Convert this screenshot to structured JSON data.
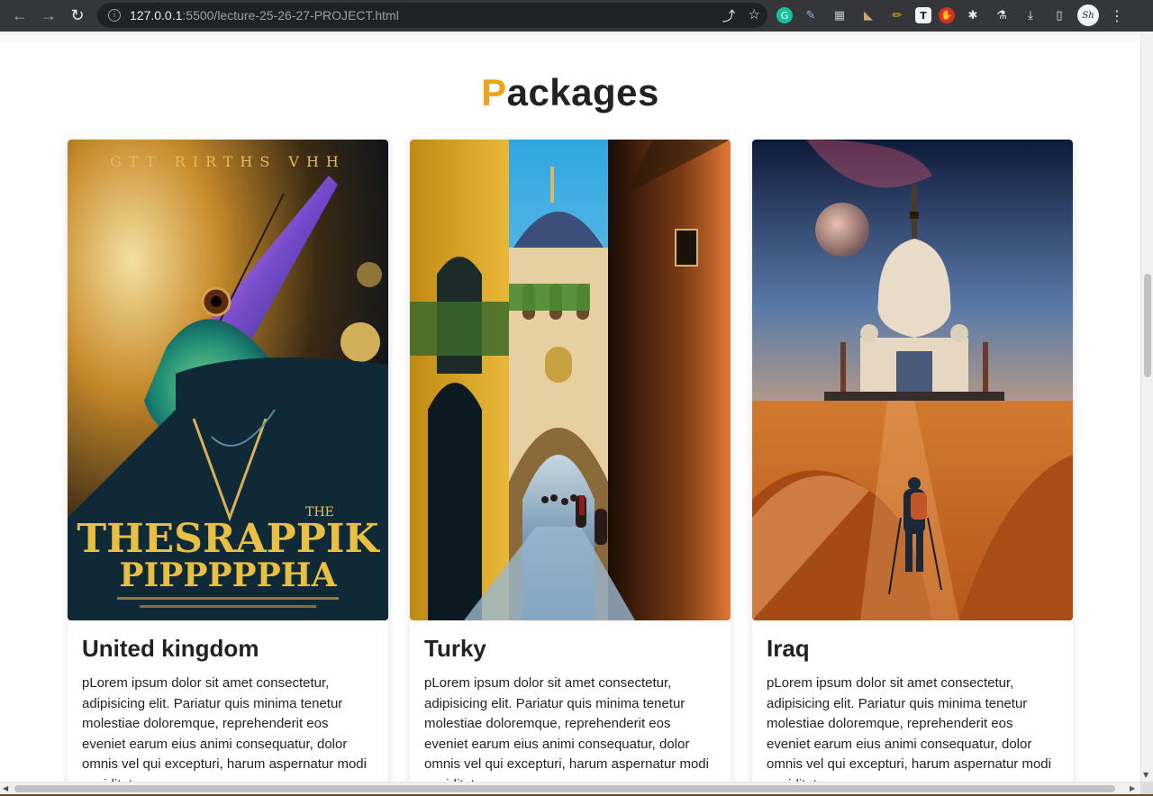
{
  "browser": {
    "url_host": "127.0.0.1",
    "url_rest": ":5500/lecture-25-26-27-PROJECT.html",
    "icons": [
      "back-arrow-icon",
      "forward-arrow-icon",
      "reload-icon",
      "site-info-icon",
      "share-icon",
      "bookmark-star-icon",
      "grammarly-icon",
      "eyedropper-icon",
      "extension-icon",
      "extension-icon",
      "pencil-icon",
      "extension-icon",
      "extension-icon",
      "puzzle-icon",
      "flask-icon",
      "download-icon",
      "sidepanel-icon",
      "profile-avatar",
      "more-menu-icon"
    ]
  },
  "section": {
    "heading_first": "P",
    "heading_rest": "ackages"
  },
  "cards": [
    {
      "title": "United kingdom",
      "text": "pLorem ipsum dolor sit amet consectetur, adipisicing elit. Pariatur quis minima tenetur molestiae doloremque, reprehenderit eos eveniet earum eius animi consequatur, dolor omnis vel qui excepturi, harum aspernatur modi cupiditate.",
      "image_alt": "chameleon in suit poster",
      "poster_top": "GTT RIRTHS VHH",
      "poster_big1": "THESRAPPIK",
      "poster_big2": "PIPPPPPHA",
      "poster_small": "THE"
    },
    {
      "title": "Turky",
      "text": "pLorem ipsum dolor sit amet consectetur, adipisicing elit. Pariatur quis minima tenetur molestiae doloremque, reprehenderit eos eveniet earum eius animi consequatur, dolor omnis vel qui excepturi, harum aspernatur modi cupiditate.",
      "image_alt": "narrow street with mosque"
    },
    {
      "title": "Iraq",
      "text": "pLorem ipsum dolor sit amet consectetur, adipisicing elit. Pariatur quis minima tenetur molestiae doloremque, reprehenderit eos eveniet earum eius animi consequatur, dolor omnis vel qui excepturi, harum aspernatur modi cupiditate.",
      "image_alt": "traveler walking toward palace in desert"
    }
  ]
}
